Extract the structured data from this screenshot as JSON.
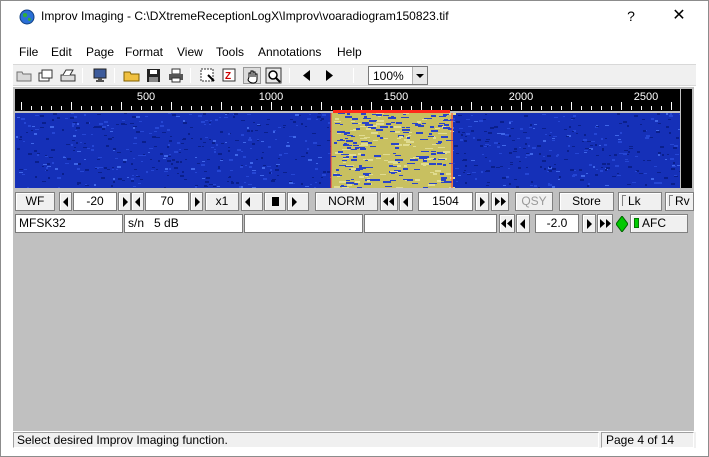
{
  "window": {
    "title": "Improv Imaging - C:\\DXtremeReceptionLogX\\Improv\\voaradiogram150823.tif",
    "help_label": "?",
    "close_label": "✕"
  },
  "menu": [
    "File",
    "Edit",
    "Page",
    "Format",
    "View",
    "Tools",
    "Annotations",
    "Help"
  ],
  "toolbar": {
    "icons": [
      "open-page-icon",
      "pages-icon",
      "scanner-icon",
      "monitor-icon",
      "open-folder-icon",
      "save-icon",
      "print-icon",
      "select-icon",
      "zoom-area-icon",
      "hand-pan-icon",
      "zoom-fit-icon",
      "previous-page-icon",
      "next-page-icon"
    ],
    "zoom": "100%"
  },
  "ruler": {
    "labels": [
      "500",
      "1000",
      "1500",
      "2000",
      "2500"
    ],
    "tuned_band_color": "#ff2a1a"
  },
  "waterfall": {
    "background_color": "#1530b8",
    "signal_color": "#c8c060"
  },
  "controls": {
    "mode": "WF",
    "ref_level": "-20",
    "range": "70",
    "speed": "x1",
    "bandwidth": "NORM",
    "frequency": "1504",
    "qsy": "QSY",
    "store": "Store",
    "lock": "Lk",
    "reverse": "Rv"
  },
  "decoder": {
    "mode": "MFSK32",
    "sn_label": "s/n",
    "sn_value": "5 dB",
    "offset": "-2.0",
    "afc": "AFC"
  },
  "status": {
    "message": "Select desired Improv Imaging function.",
    "page": "Page 4 of 14"
  }
}
